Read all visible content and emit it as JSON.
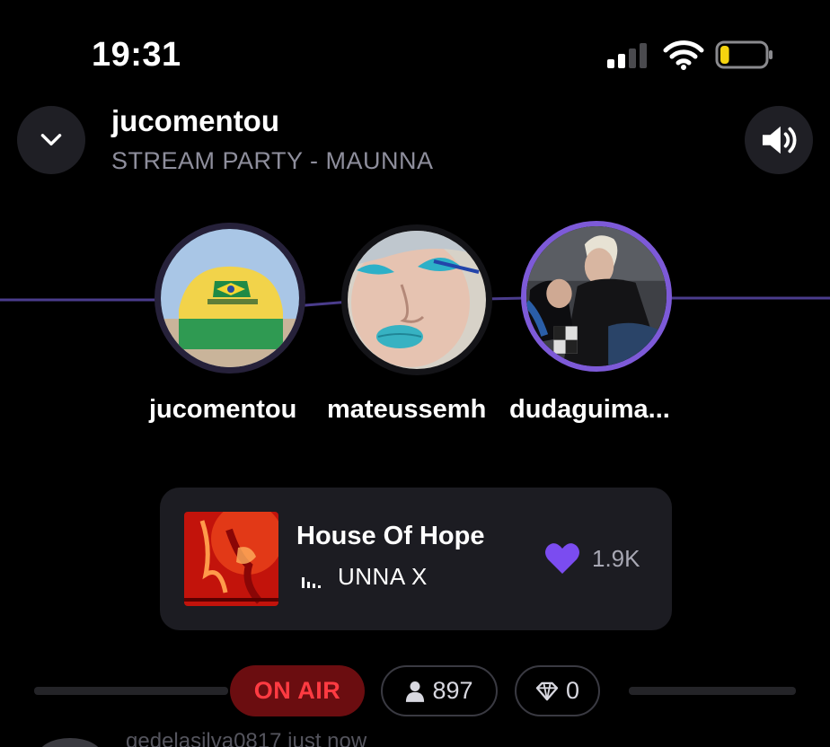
{
  "status_bar": {
    "time": "19:31",
    "signal_icon": "cellular-signal-icon",
    "wifi_icon": "wifi-icon",
    "battery_icon": "battery-icon",
    "battery_level": 0.2,
    "battery_color": "#f5d40f"
  },
  "header": {
    "collapse_icon": "chevron-down-icon",
    "host_name": "jucomentou",
    "room_subtitle": "STREAM PARTY - MAUNNA",
    "sound_icon": "speaker-volume-icon"
  },
  "participants": [
    {
      "name": "jucomentou"
    },
    {
      "name": "mateussemh"
    },
    {
      "name": "dudaguima..."
    }
  ],
  "now_playing": {
    "title": "House Of Hope",
    "artist": "UNNA X",
    "equalizer_icon": "equalizer-bars-icon",
    "like_icon": "heart-icon",
    "likes": "1.9K",
    "accent_color": "#7b4cf0"
  },
  "live_bar": {
    "on_air_label": "ON AIR",
    "viewer_icon": "person-icon",
    "viewers": "897",
    "gem_icon": "diamond-icon",
    "gems": "0"
  },
  "comment_preview": {
    "text": "gedelasilva0817  just now"
  }
}
